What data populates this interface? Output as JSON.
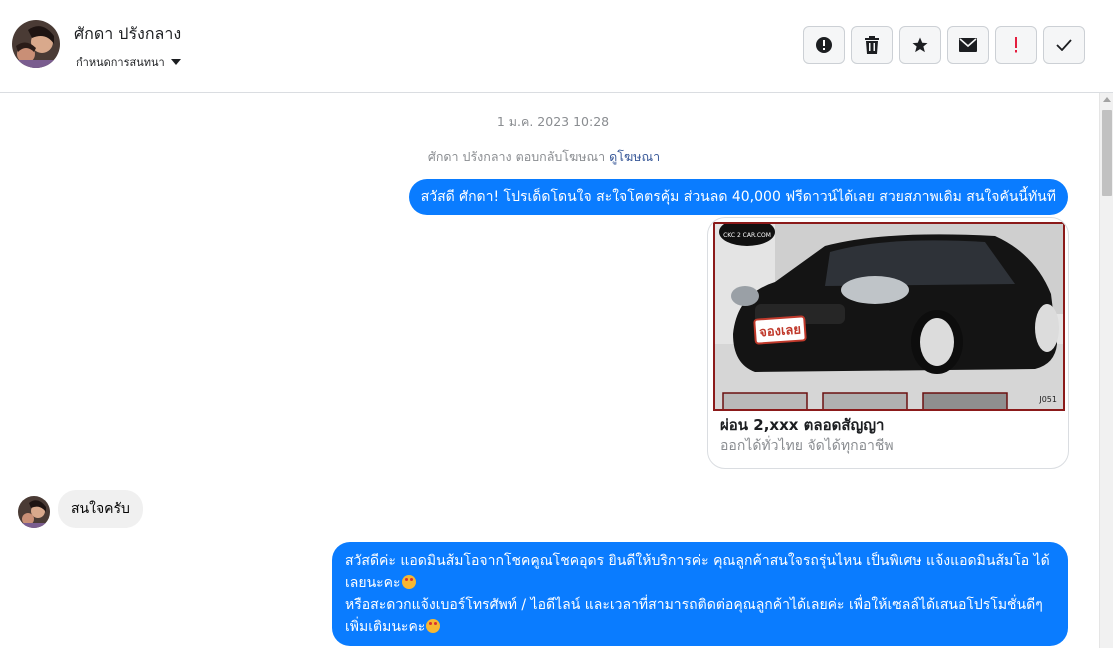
{
  "header": {
    "contact_name": "ศักดา ปรังกลาง",
    "assign_label": "กำหนดการสนทนา",
    "toolbar": [
      {
        "name": "report-button",
        "icon": "alert-circle-icon"
      },
      {
        "name": "delete-button",
        "icon": "trash-icon"
      },
      {
        "name": "star-button",
        "icon": "star-icon"
      },
      {
        "name": "mark-unread-button",
        "icon": "envelope-icon"
      },
      {
        "name": "follow-up-button",
        "icon": "exclamation-icon"
      },
      {
        "name": "mark-done-button",
        "icon": "checkmark-icon"
      }
    ]
  },
  "conversation": {
    "timestamp": "1 ม.ค. 2023 10:28",
    "reply_note": "ศักดา ปรังกลาง ตอบกลับโฆษณา",
    "reply_link": "ดูโฆษณา",
    "messages": {
      "greeting": "สวัสดี ศักดา! โปรเด็ดโดนใจ สะใจโคตรคุ้ม ส่วนลด 40,000 ฟรีดาวน์ได้เลย สวยสภาพเดิม สนใจคันนี้ทันที",
      "card_title": "ผ่อน 2,xxx ตลอดสัญญา",
      "card_desc": "ออกได้ทั่วไทย จัดได้ทุกอาชีพ",
      "card_watermark": "CKC 2 CAR.COM",
      "card_sticker": "จองเลย",
      "card_code": "J051",
      "customer_reply": "สนใจครับ",
      "admin_reply_line1": "สวัสดีค่ะ แอดมินส้มโอจากโชคคูณโชคอุดร ยินดีให้บริการค่ะ   คุณลูกค้าสนใจรถรุ่นไหน เป็นพิเศษ แจ้งแอดมินส้มโอ ได้เลยนะคะ",
      "admin_reply_line2": "หรือสะดวกแจ้งเบอร์โทรศัพท์ / ไอดีไลน์ และเวลาที่สามารถติดต่อคุณลูกค้าได้เลยค่ะ เพื่อให้เซลล์ได้เสนอโปรโมชั่นดีๆเพิ่มเติมนะคะ"
    }
  },
  "colors": {
    "outgoing_bubble": "#0a7cff",
    "incoming_bubble": "#f0f0f0",
    "follow_up_red": "#e41e3f",
    "link": "#385898"
  }
}
